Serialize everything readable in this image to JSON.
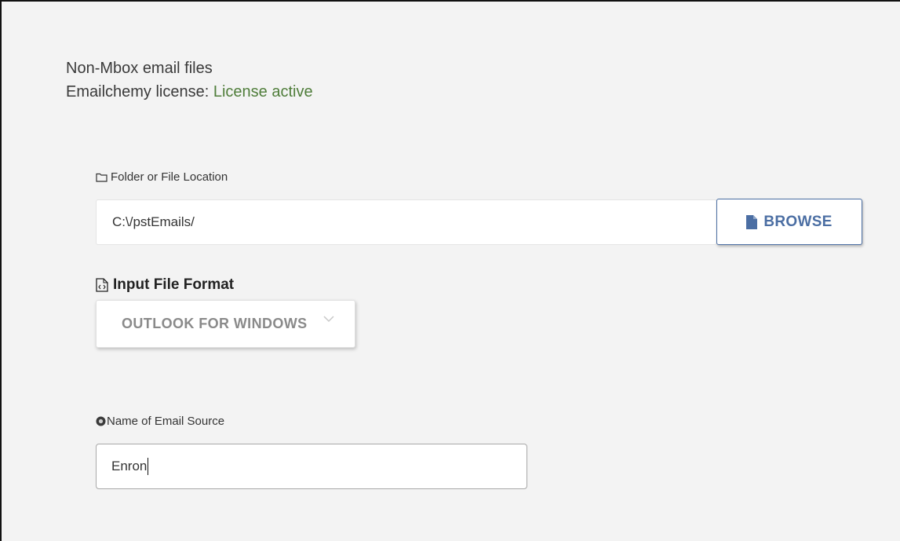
{
  "header": {
    "title": "Non-Mbox email files",
    "license_label": "Emailchemy license: ",
    "license_status": "License active",
    "license_status_color": "#4f7d3a"
  },
  "folder_field": {
    "icon": "folder-icon",
    "label": "Folder or File Location",
    "value": "C:\\/pstEmails/"
  },
  "browse_button": {
    "icon": "file-icon",
    "label": "BROWSE"
  },
  "format_field": {
    "icon": "code-file-icon",
    "label": "Input File Format",
    "selected": "OUTLOOK FOR WINDOWS",
    "chevron_icon": "chevron-down-icon"
  },
  "source_field": {
    "icon": "info-circle-icon",
    "label": "Name of Email Source",
    "value": "Enron"
  },
  "colors": {
    "accent": "#4b6ea3",
    "background": "#f3f3f3"
  }
}
